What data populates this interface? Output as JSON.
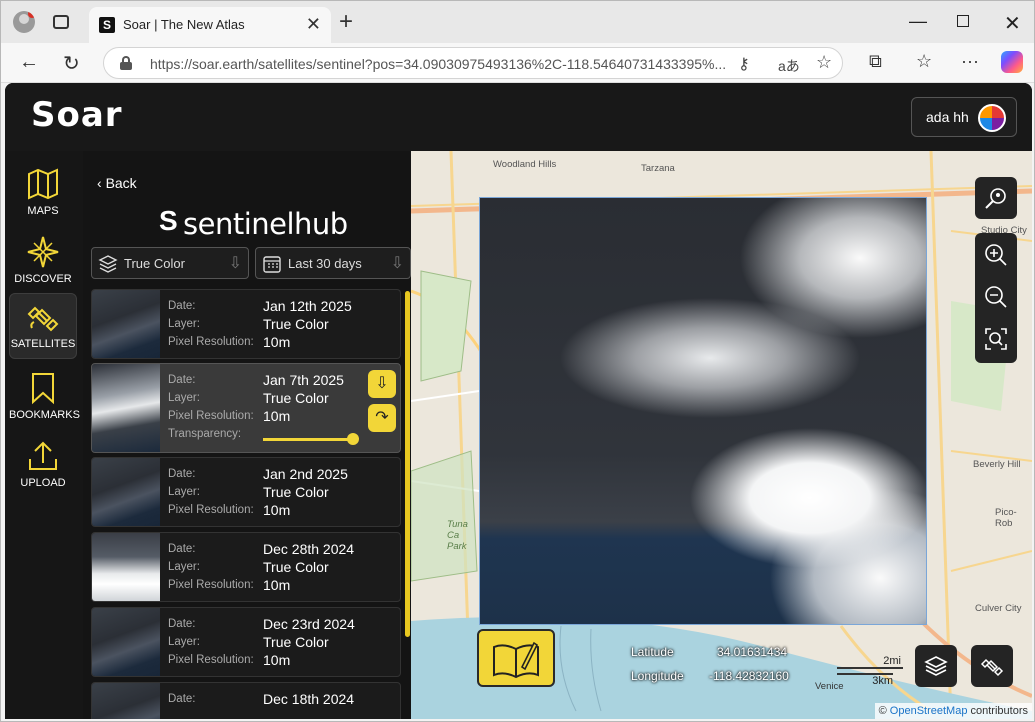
{
  "browser": {
    "tab_title": "Soar | The New Atlas",
    "tab_favicon": "S",
    "url_host": "https://soar.earth",
    "url_path": "/satellites/sentinel?pos=34.09030975493136%2C-118.54640731433395%..."
  },
  "app": {
    "logo": "Soar",
    "user_name": "ada hh"
  },
  "rail": {
    "items": [
      {
        "label": "MAPS",
        "icon": "map-icon"
      },
      {
        "label": "DISCOVER",
        "icon": "compass-star-icon"
      },
      {
        "label": "SATELLITES",
        "icon": "satellite-icon"
      },
      {
        "label": "BOOKMARKS",
        "icon": "bookmark-icon"
      },
      {
        "label": "UPLOAD",
        "icon": "upload-icon"
      }
    ]
  },
  "panel": {
    "back_label": "Back",
    "brand": "sentinelhub",
    "layer_select": "True Color",
    "range_select": "Last 30 days",
    "field_labels": {
      "date": "Date:",
      "layer": "Layer:",
      "res": "Pixel Resolution:",
      "transparency": "Transparency:"
    },
    "transparency_value": 1.0,
    "results": [
      {
        "date": "Jan 12th 2025",
        "layer": "True Color",
        "res": "10m"
      },
      {
        "date": "Jan 7th 2025",
        "layer": "True Color",
        "res": "10m"
      },
      {
        "date": "Jan 2nd 2025",
        "layer": "True Color",
        "res": "10m"
      },
      {
        "date": "Dec 28th 2024",
        "layer": "True Color",
        "res": "10m"
      },
      {
        "date": "Dec 23rd 2024",
        "layer": "True Color",
        "res": "10m"
      },
      {
        "date": "Dec 18th 2024",
        "layer": "",
        "res": ""
      }
    ]
  },
  "map": {
    "place_labels": [
      "Woodland Hills",
      "Tarzana",
      "Studio City",
      "Beverly Hill",
      "Pico-Rob",
      "Culver City",
      "Venice",
      "Tuna Ca Park"
    ],
    "latitude_label": "Latitude",
    "latitude_value": "34.01631434",
    "longitude_label": "Longitude",
    "longitude_value": "-118.42832160",
    "scale_mi": "2mi",
    "scale_km": "3km",
    "attribution_prefix": "©",
    "attribution_link": "OpenStreetMap",
    "attribution_suffix": "contributors"
  },
  "colors": {
    "accent": "#f2d638",
    "app_bg": "#141414"
  }
}
